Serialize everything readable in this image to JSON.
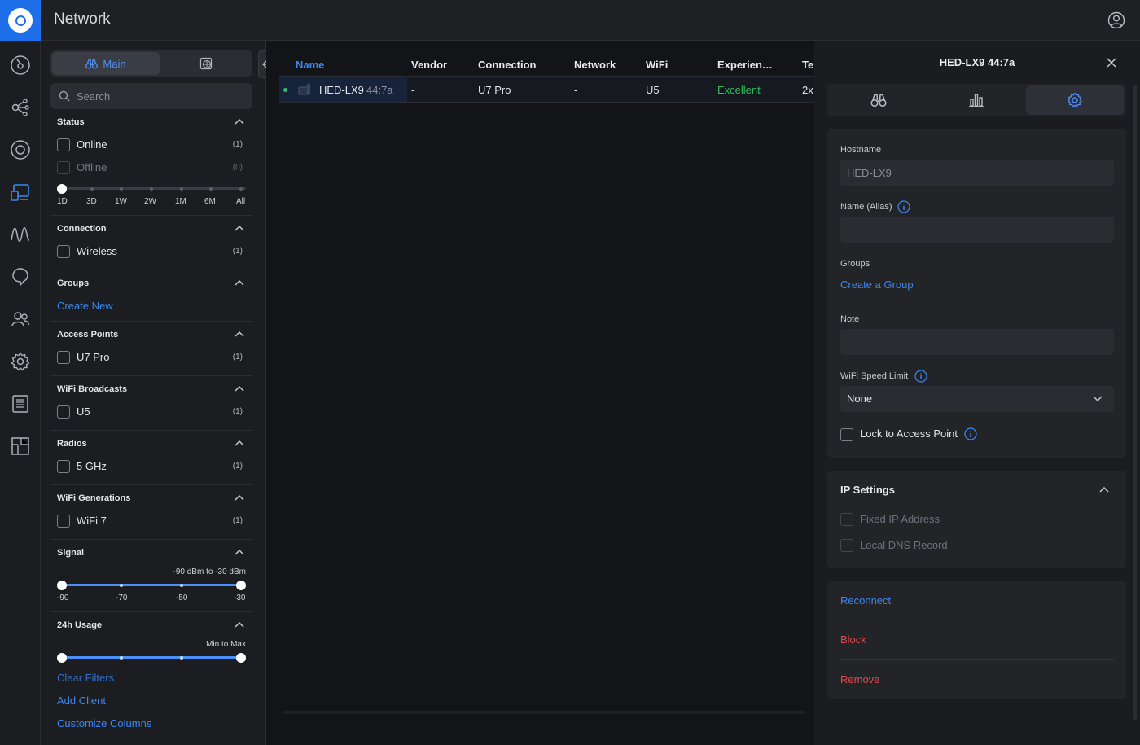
{
  "app": {
    "title": "Network"
  },
  "icons": {
    "user": "user-circle-icon",
    "nav": [
      "dashboard-icon",
      "topology-icon",
      "devices-icon",
      "clients-icon",
      "statistics-icon",
      "insights-icon",
      "admins-icon",
      "settings-icon",
      "logs-icon",
      "floorplan-icon"
    ]
  },
  "filters": {
    "main_tab": "Main",
    "search_placeholder": "Search",
    "status": {
      "title": "Status",
      "items": [
        {
          "label": "Online",
          "count": "(1)"
        },
        {
          "label": "Offline",
          "count": "(0)"
        }
      ],
      "time_ticks": [
        "1D",
        "3D",
        "1W",
        "2W",
        "1M",
        "6M",
        "All"
      ]
    },
    "connection": {
      "title": "Connection",
      "items": [
        {
          "label": "Wireless",
          "count": "(1)"
        }
      ]
    },
    "groups": {
      "title": "Groups",
      "create_link": "Create New"
    },
    "access_points": {
      "title": "Access Points",
      "items": [
        {
          "label": "U7 Pro",
          "count": "(1)"
        }
      ]
    },
    "wifi_broadcasts": {
      "title": "WiFi Broadcasts",
      "items": [
        {
          "label": "U5",
          "count": "(1)"
        }
      ]
    },
    "radios": {
      "title": "Radios",
      "items": [
        {
          "label": "5 GHz",
          "count": "(1)"
        }
      ]
    },
    "wifi_generations": {
      "title": "WiFi Generations",
      "items": [
        {
          "label": "WiFi 7",
          "count": "(1)"
        }
      ]
    },
    "signal": {
      "title": "Signal",
      "range_text": "-90 dBm to -30 dBm",
      "ticks": [
        "-90",
        "-70",
        "-50",
        "-30"
      ]
    },
    "usage": {
      "title": "24h Usage",
      "range_text": "Min to Max"
    },
    "links": {
      "clear": "Clear Filters",
      "add": "Add Client",
      "customize": "Customize Columns"
    }
  },
  "table": {
    "columns": [
      "Name",
      "Vendor",
      "Connection",
      "Network",
      "WiFi",
      "Experien…",
      "Te"
    ],
    "rows": [
      {
        "status_color": "#2fbf5f",
        "name": "HED-LX9",
        "mac_suffix": "44:7a",
        "vendor": "-",
        "connection": "U7 Pro",
        "network": "-",
        "wifi": "U5",
        "experience": "Excellent",
        "tech": "2x"
      }
    ]
  },
  "panel": {
    "title": "HED-LX9 44:7a",
    "tabs": [
      "overview-binoculars-icon",
      "insights-chart-icon",
      "settings-gear-icon"
    ],
    "selected_tab": "settings-gear-icon",
    "hostname_label": "Hostname",
    "hostname_value": "HED-LX9",
    "alias_label": "Name (Alias)",
    "alias_value": "",
    "groups_label": "Groups",
    "groups_link": "Create a Group",
    "note_label": "Note",
    "note_value": "",
    "speed_label": "WiFi Speed Limit",
    "speed_value": "None",
    "lock_label": "Lock to Access Point",
    "ip_title": "IP Settings",
    "fixed_ip_label": "Fixed IP Address",
    "local_dns_label": "Local DNS Record",
    "actions": {
      "reconnect": "Reconnect",
      "block": "Block",
      "remove": "Remove"
    }
  },
  "colors": {
    "accent": "#3b87f2",
    "success": "#2fbf5f",
    "danger": "#e5484d",
    "brand": "#1f6feb"
  }
}
